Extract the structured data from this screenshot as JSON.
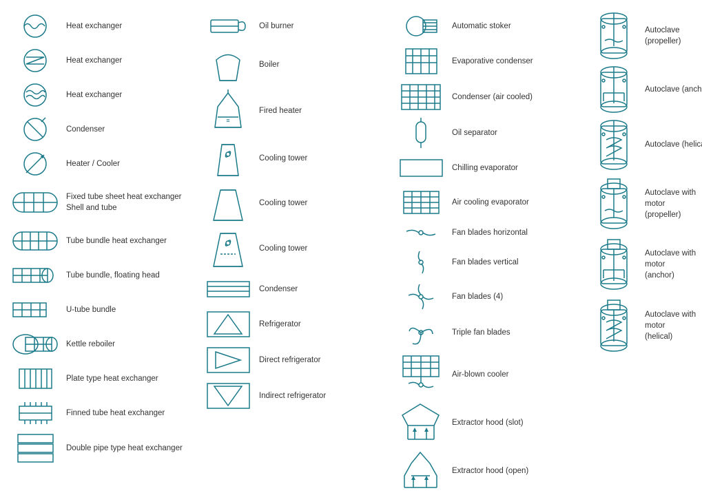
{
  "col1": {
    "items": [
      {
        "id": "heat-exchanger-1",
        "label": "Heat exchanger"
      },
      {
        "id": "heat-exchanger-2",
        "label": "Heat exchanger"
      },
      {
        "id": "heat-exchanger-3",
        "label": "Heat exchanger"
      },
      {
        "id": "condenser",
        "label": "Condenser"
      },
      {
        "id": "heater-cooler",
        "label": "Heater / Cooler"
      },
      {
        "id": "fixed-tube",
        "label": "Fixed tube sheet heat exchanger\nShell and tube"
      },
      {
        "id": "tube-bundle",
        "label": "Tube bundle heat exchanger"
      },
      {
        "id": "tube-bundle-floating",
        "label": "Tube bundle, floating head"
      },
      {
        "id": "u-tube",
        "label": "U-tube bundle"
      },
      {
        "id": "kettle",
        "label": "Kettle reboiler"
      },
      {
        "id": "plate-type",
        "label": "Plate type heat exchanger"
      },
      {
        "id": "finned-tube",
        "label": "Finned tube heat exchanger"
      },
      {
        "id": "double-pipe",
        "label": "Double pipe type heat exchanger"
      }
    ]
  },
  "col2": {
    "items": [
      {
        "id": "oil-burner",
        "label": "Oil burner"
      },
      {
        "id": "boiler",
        "label": "Boiler"
      },
      {
        "id": "fired-heater",
        "label": "Fired heater"
      },
      {
        "id": "cooling-tower-1",
        "label": "Cooling tower"
      },
      {
        "id": "cooling-tower-2",
        "label": "Cooling tower"
      },
      {
        "id": "cooling-tower-3",
        "label": "Cooling tower"
      },
      {
        "id": "condenser2",
        "label": "Condenser"
      },
      {
        "id": "refrigerator",
        "label": "Refrigerator"
      },
      {
        "id": "direct-refrigerator",
        "label": "Direct refrigerator"
      },
      {
        "id": "indirect-refrigerator",
        "label": "Indirect refrigerator"
      }
    ]
  },
  "col3": {
    "items": [
      {
        "id": "automatic-stoker",
        "label": "Automatic stoker"
      },
      {
        "id": "evaporative-condenser",
        "label": "Evaporative condenser"
      },
      {
        "id": "condenser-air-cooled",
        "label": "Condenser (air cooled)"
      },
      {
        "id": "oil-separator",
        "label": "Oil separator"
      },
      {
        "id": "chilling-evaporator",
        "label": "Chilling evaporator"
      },
      {
        "id": "air-cooling-evaporator",
        "label": "Air cooling evaporator"
      },
      {
        "id": "fan-blades-horizontal",
        "label": "Fan blades horizontal"
      },
      {
        "id": "fan-blades-vertical",
        "label": "Fan blades vertical"
      },
      {
        "id": "fan-blades-4",
        "label": "Fan blades (4)"
      },
      {
        "id": "triple-fan-blades",
        "label": "Triple fan blades"
      },
      {
        "id": "air-blown-cooler",
        "label": "Air-blown cooler"
      },
      {
        "id": "extractor-hood-slot",
        "label": "Extractor hood (slot)"
      },
      {
        "id": "extractor-hood-open",
        "label": "Extractor hood (open)"
      }
    ]
  },
  "col4": {
    "items": [
      {
        "id": "autoclave-propeller",
        "label": "Autoclave (propeller)"
      },
      {
        "id": "autoclave-anchor",
        "label": "Autoclave (anchor)"
      },
      {
        "id": "autoclave-helical",
        "label": "Autoclave (helical)"
      },
      {
        "id": "autoclave-motor-propeller",
        "label": "Autoclave with motor\n(propeller)"
      },
      {
        "id": "autoclave-motor-anchor",
        "label": "Autoclave with motor\n(anchor)"
      },
      {
        "id": "autoclave-motor-helical",
        "label": "Autoclave with motor\n(helical)"
      }
    ]
  }
}
